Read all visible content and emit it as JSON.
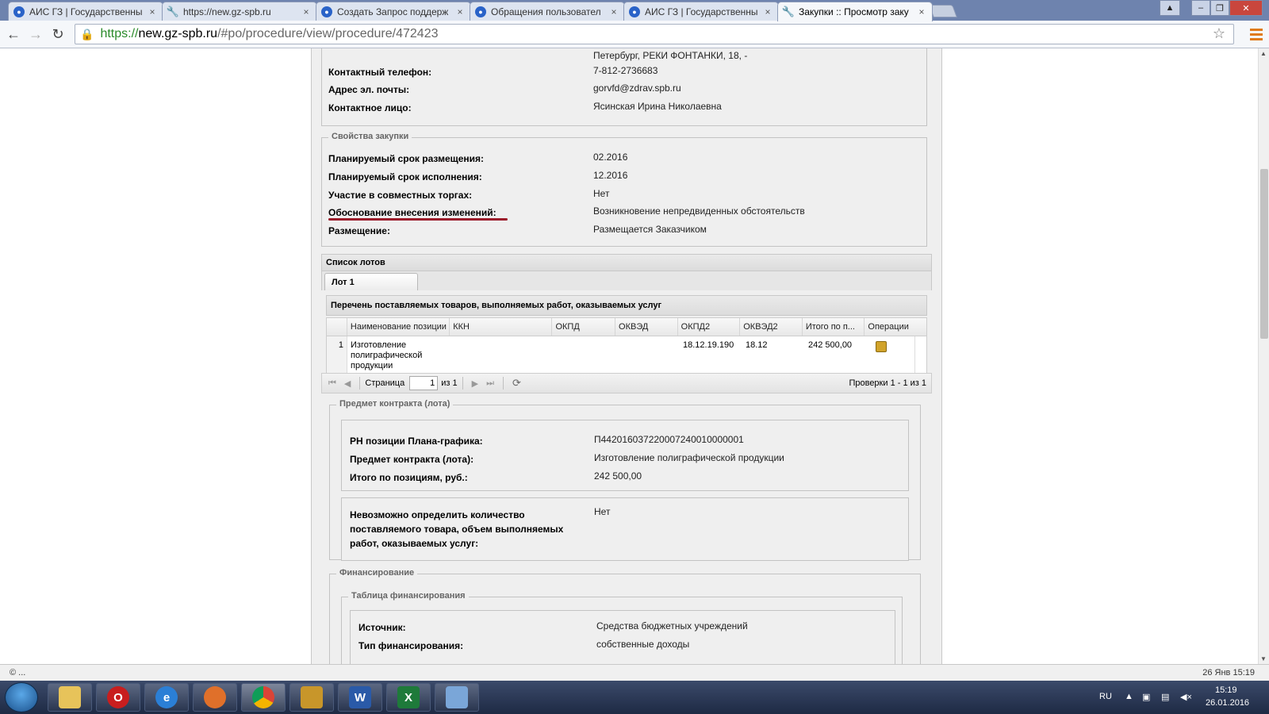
{
  "browser": {
    "tabs": [
      {
        "title": "АИС ГЗ | Государственны",
        "icon": "globe-icon"
      },
      {
        "title": "https://new.gz-spb.ru",
        "icon": "wrench-icon"
      },
      {
        "title": "Создать Запрос поддерж",
        "icon": "globe-icon"
      },
      {
        "title": "Обращения пользовател",
        "icon": "globe-icon"
      },
      {
        "title": "АИС ГЗ | Государственны",
        "icon": "globe-icon"
      },
      {
        "title": "Закупки :: Просмотр заку",
        "icon": "wrench-icon"
      }
    ],
    "url_protocol": "https://",
    "url_host": "new.gz-spb.ru",
    "url_path": "/#po/procedure/view/procedure/472423",
    "tab_close": "×"
  },
  "contacts": {
    "address_cont": "Петербург, РЕКИ ФОНТАНКИ, 18, -",
    "phone_label": "Контактный телефон:",
    "phone": "7-812-2736683",
    "email_label": "Адрес эл. почты:",
    "email": "gorvfd@zdrav.spb.ru",
    "person_label": "Контактное лицо:",
    "person": "Ясинская Ирина Николаевна"
  },
  "properties": {
    "legend": "Свойства закупки",
    "rows": [
      {
        "label": "Планируемый срок размещения:",
        "value": "02.2016"
      },
      {
        "label": "Планируемый срок исполнения:",
        "value": "12.2016"
      },
      {
        "label": "Участие в совместных торгах:",
        "value": "Нет"
      },
      {
        "label": "Обоснование внесения изменений:",
        "value": "Возникновение непредвиденных обстоятельств"
      },
      {
        "label": "Размещение:",
        "value": "Размещается Заказчиком"
      }
    ]
  },
  "lots": {
    "title": "Список лотов",
    "tab": "Лот 1",
    "goods_title": "Перечень поставляемых товаров, выполняемых работ, оказываемых услуг",
    "columns": [
      "Наименование позиции",
      "ККН",
      "ОКПД",
      "ОКВЭД",
      "ОКПД2",
      "ОКВЭД2",
      "Итого по п...",
      "Операции"
    ],
    "rows": [
      {
        "n": "1",
        "name": "Изготовление полиграфической продукции",
        "kkn": "",
        "okpd": "",
        "okved": "",
        "okpd2": "18.12.19.190",
        "okved2": "18.12",
        "total": "242 500,00"
      }
    ],
    "pager": {
      "page_label": "Страница",
      "page": "1",
      "of": "из 1",
      "info": "Проверки 1 - 1 из 1"
    }
  },
  "contract": {
    "legend": "Предмет контракта (лота)",
    "rows": [
      {
        "label": "РН позиции Плана-графика:",
        "value": "П442016037220007240010000001"
      },
      {
        "label": "Предмет контракта (лота):",
        "value": "Изготовление полиграфической продукции"
      },
      {
        "label": "Итого по позициям, руб.:",
        "value": "242 500,00"
      }
    ],
    "qty_label": "Невозможно определить количество поставляемого товара, объем выполняемых работ, оказываемых услуг:",
    "qty_value": "Нет"
  },
  "financing": {
    "legend": "Финансирование",
    "table_legend": "Таблица финансирования",
    "rows": [
      {
        "label": "Источник:",
        "value": "Средства бюджетных учреждений"
      },
      {
        "label": "Тип финансирования:",
        "value": "собственные доходы"
      }
    ]
  },
  "statusbar": {
    "left": "© ...",
    "right": "26 Янв 15:19"
  },
  "taskbar": {
    "lang": "RU",
    "time": "15:19",
    "date": "26.01.2016",
    "apps": [
      "explorer-icon",
      "opera-icon",
      "ie-icon",
      "firefox-icon",
      "chrome-icon",
      "archive-icon",
      "word-icon",
      "excel-icon",
      "paint-icon"
    ]
  },
  "colors": {
    "accent_underline": "#9b1b2a",
    "panel_bg": "#efefef"
  }
}
